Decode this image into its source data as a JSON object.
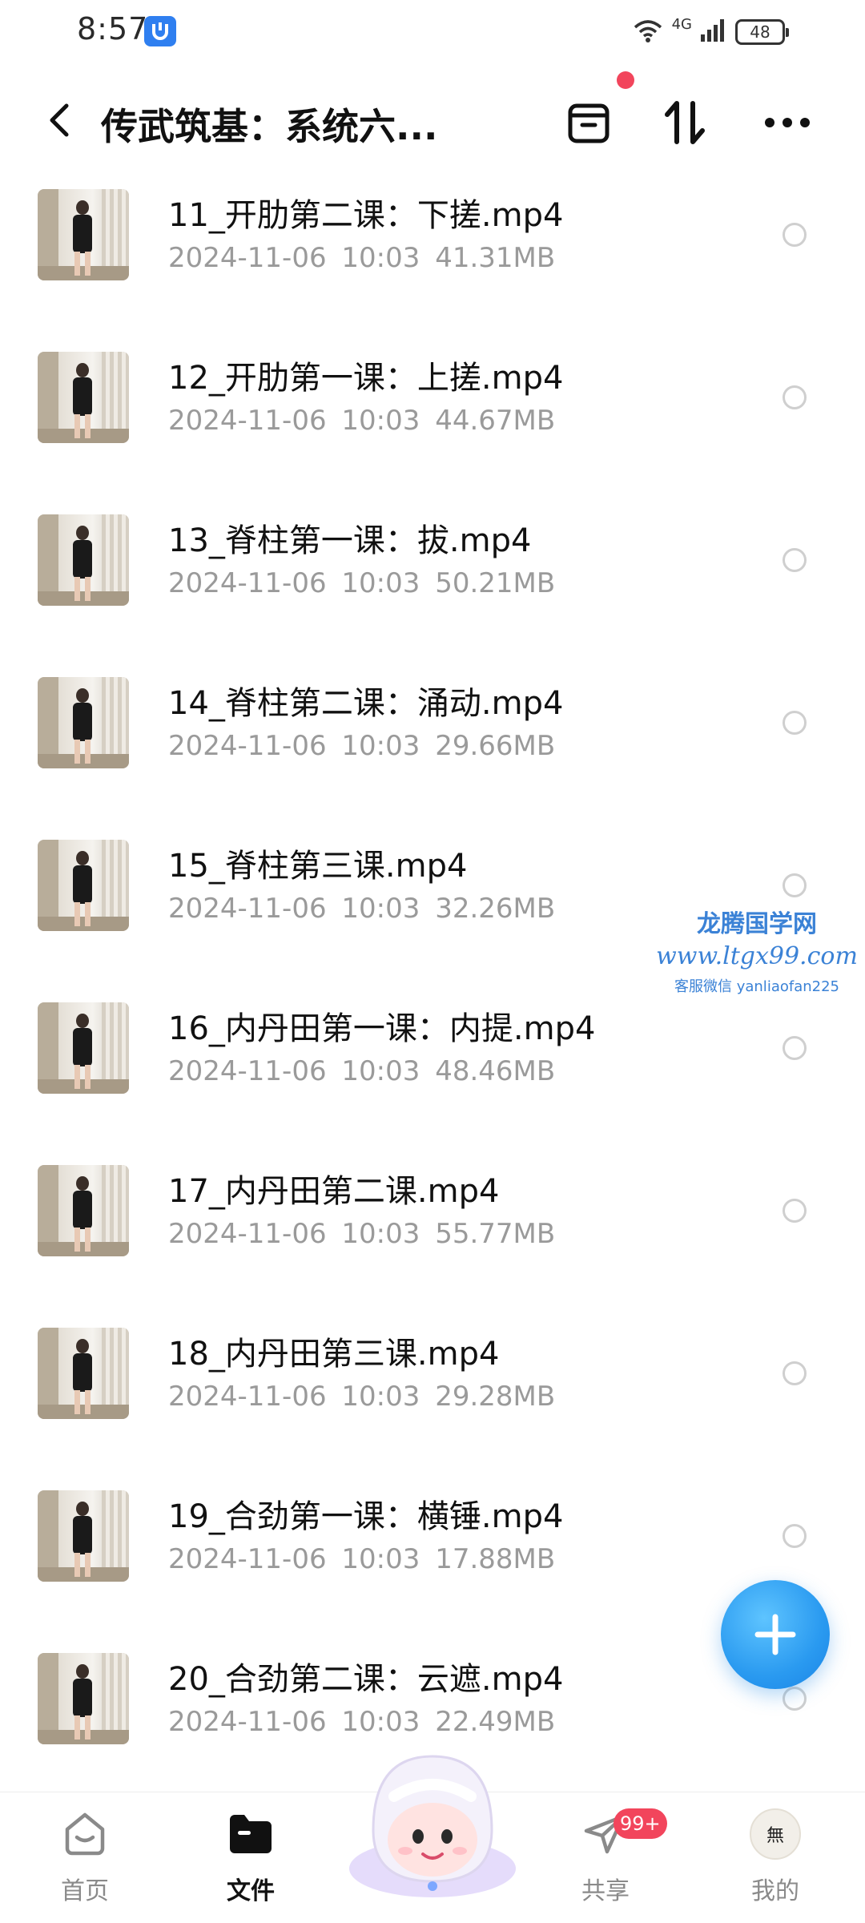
{
  "status_bar": {
    "time": "8:57",
    "network": "4G",
    "battery": "48"
  },
  "header": {
    "title": "传武筑基：系统六...",
    "back_icon": "chevron-left-icon",
    "actions": [
      "transfer-box-icon",
      "sort-icon",
      "more-icon"
    ]
  },
  "files": [
    {
      "name": "11_开肋第二课：下搓.mp4",
      "date": "2024-11-06",
      "time": "10:03",
      "size": "41.31MB"
    },
    {
      "name": "12_开肋第一课：上搓.mp4",
      "date": "2024-11-06",
      "time": "10:03",
      "size": "44.67MB"
    },
    {
      "name": "13_脊柱第一课：拔.mp4",
      "date": "2024-11-06",
      "time": "10:03",
      "size": "50.21MB"
    },
    {
      "name": "14_脊柱第二课：涌动.mp4",
      "date": "2024-11-06",
      "time": "10:03",
      "size": "29.66MB"
    },
    {
      "name": "15_脊柱第三课.mp4",
      "date": "2024-11-06",
      "time": "10:03",
      "size": "32.26MB"
    },
    {
      "name": "16_内丹田第一课：内提.mp4",
      "date": "2024-11-06",
      "time": "10:03",
      "size": "48.46MB"
    },
    {
      "name": "17_内丹田第二课.mp4",
      "date": "2024-11-06",
      "time": "10:03",
      "size": "55.77MB"
    },
    {
      "name": "18_内丹田第三课.mp4",
      "date": "2024-11-06",
      "time": "10:03",
      "size": "29.28MB"
    },
    {
      "name": "19_合劲第一课：横锤.mp4",
      "date": "2024-11-06",
      "time": "10:03",
      "size": "17.88MB"
    },
    {
      "name": "20_合劲第二课：云遮.mp4",
      "date": "2024-11-06",
      "time": "10:03",
      "size": "22.49MB"
    }
  ],
  "watermark": {
    "line1": "龙腾国学网",
    "line2": "www.ltgx99.com",
    "line3": "客服微信 yanliaofan225"
  },
  "fab": {
    "icon": "plus-icon"
  },
  "bottom_nav": {
    "items": [
      {
        "label": "首页",
        "icon": "home-icon"
      },
      {
        "label": "文件",
        "icon": "folder-icon",
        "active": true
      },
      {
        "label": "共享",
        "icon": "send-icon",
        "badge": "99+"
      },
      {
        "label": "我的",
        "icon": "avatar"
      }
    ]
  },
  "colors": {
    "accent": "#2a9af0",
    "badge": "#f2455c",
    "meta_text": "#9a9a9a"
  }
}
